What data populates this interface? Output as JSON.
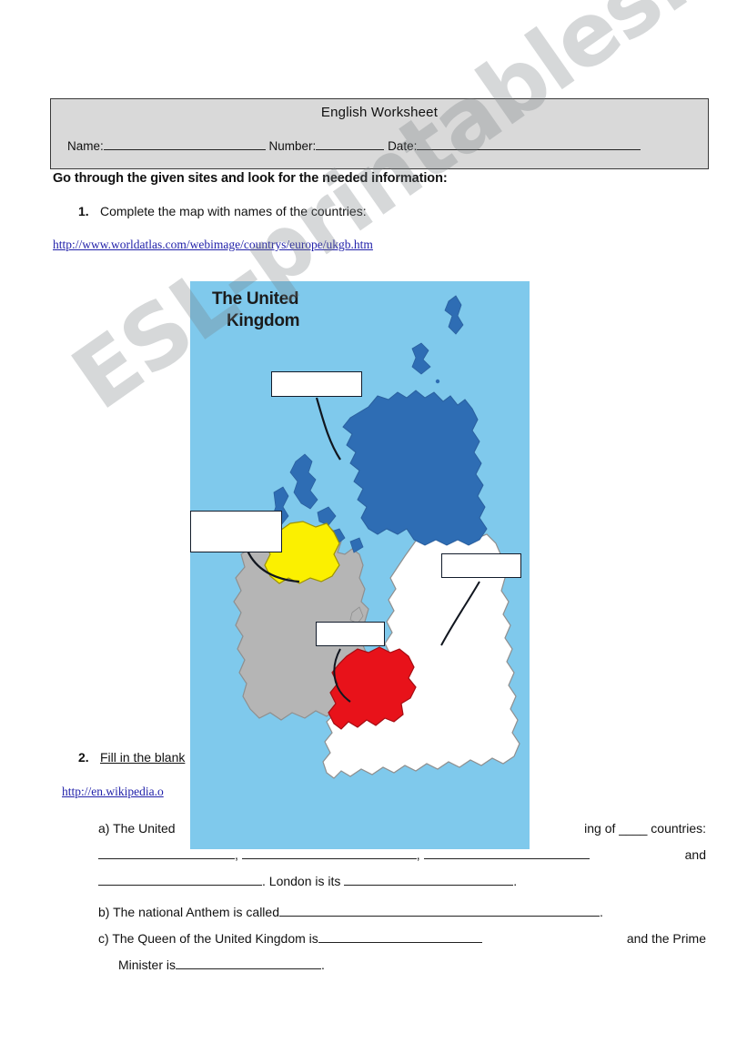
{
  "header": {
    "title": "English Worksheet",
    "name_label": "Name:",
    "number_label": "Number:",
    "date_label": "Date:"
  },
  "instructions": {
    "main": "Go through the given sites and look for the needed information:"
  },
  "task1": {
    "number": "1.",
    "text": "Complete the map with names of the countries:",
    "link": "http://www.worldatlas.com/webimage/countrys/europe/ukgb.htm"
  },
  "task2": {
    "number": "2.",
    "text": "Fill in the blank",
    "link": "http://en.wikipedia.o"
  },
  "map": {
    "title_line1": "The United",
    "title_line2": "Kingdom",
    "ocean_color": "#7fc9ec",
    "scotland_color": "#2e6db4",
    "england_color": "#ffffff",
    "wales_color": "#e8121a",
    "northern_ireland_color": "#fbf000",
    "ireland_color": "#b5b5b5",
    "label_boxes": [
      {
        "name": "scotland-label-box",
        "value": ""
      },
      {
        "name": "northern-ireland-label-box",
        "value": ""
      },
      {
        "name": "england-label-box",
        "value": ""
      },
      {
        "name": "wales-label-box",
        "value": ""
      }
    ]
  },
  "questions": {
    "a": {
      "label": "a)",
      "line1_start": "The United",
      "line1_end": "ing of ____ countries:",
      "line2_end": "and",
      "line3_mid": ". London is its",
      "line3_end": "."
    },
    "b": {
      "label": "b)",
      "text": "The national Anthem is called",
      "end": "."
    },
    "c": {
      "label": "c)",
      "line1_start": "The Queen of the United Kingdom is",
      "line1_end": "and  the  Prime",
      "line2_start": "Minister is",
      "line2_end": "."
    }
  },
  "watermark": {
    "text": "ESL-printables.com"
  }
}
